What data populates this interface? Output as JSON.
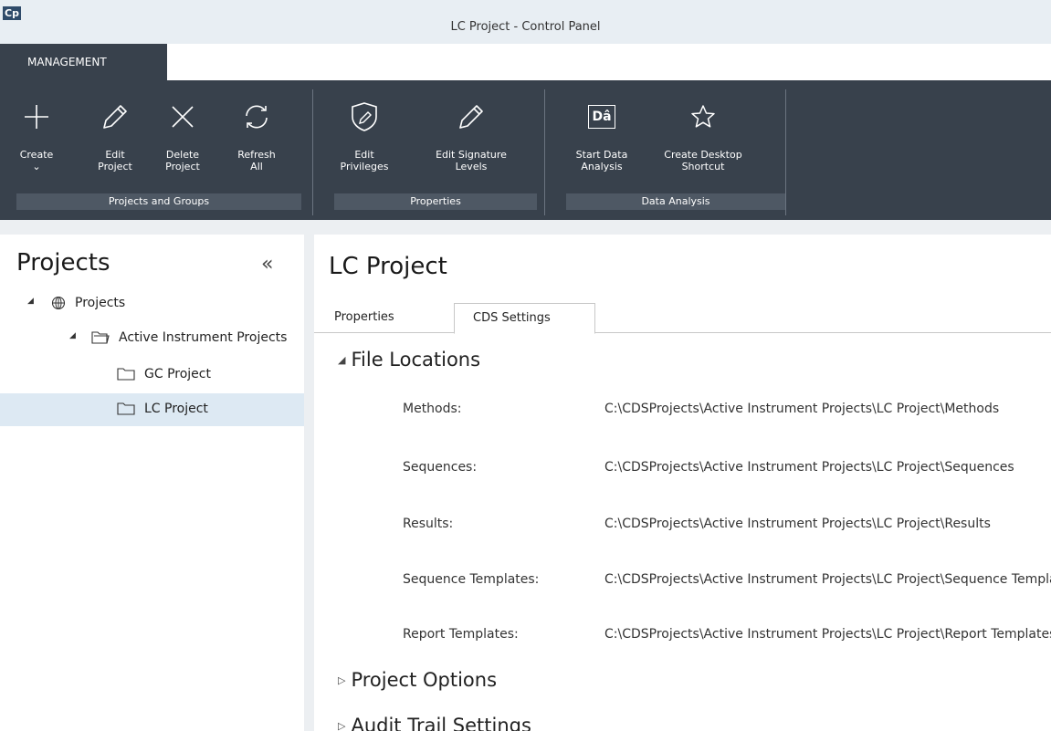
{
  "app": {
    "icon_text": "Cp",
    "window_title": "LC Project - Control Panel"
  },
  "ribbon": {
    "tab": "MANAGEMENT",
    "groups": [
      {
        "label": "Projects and Groups",
        "buttons": [
          {
            "label": "Create\n⌄",
            "icon": "plus-icon"
          },
          {
            "label": "Edit\nProject",
            "icon": "pencil-icon"
          },
          {
            "label": "Delete\nProject",
            "icon": "x-icon"
          },
          {
            "label": "Refresh\nAll",
            "icon": "refresh-icon"
          }
        ]
      },
      {
        "label": "Properties",
        "buttons": [
          {
            "label": "Edit\nPrivileges",
            "icon": "shield-edit-icon"
          },
          {
            "label": "Edit Signature\nLevels",
            "icon": "pencil-icon"
          }
        ]
      },
      {
        "label": "Data Analysis",
        "buttons": [
          {
            "label": "Start Data\nAnalysis",
            "icon": "data-analysis-icon",
            "icon_text": "Dâ"
          },
          {
            "label": "Create Desktop\nShortcut",
            "icon": "star-icon"
          }
        ]
      }
    ]
  },
  "left_pane": {
    "title": "Projects",
    "collapse": "«",
    "tree": [
      {
        "label": "Projects",
        "icon": "globe-icon",
        "expanded": true
      },
      {
        "label": "Active Instrument Projects",
        "icon": "folder-open-icon",
        "expanded": true
      },
      {
        "label": "GC Project",
        "icon": "folder-icon"
      },
      {
        "label": "LC Project",
        "icon": "folder-icon",
        "selected": true
      }
    ]
  },
  "main": {
    "title": "LC Project",
    "tabs": [
      {
        "label": "Properties"
      },
      {
        "label": "CDS Settings",
        "active": true
      }
    ],
    "sections": [
      {
        "title": "File Locations",
        "expanded": true
      },
      {
        "title": "Project Options",
        "expanded": false
      },
      {
        "title": "Audit Trail Settings",
        "expanded": false
      }
    ],
    "file_locations": [
      {
        "label": "Methods:",
        "value": "C:\\CDSProjects\\Active Instrument Projects\\LC Project\\Methods"
      },
      {
        "label": "Sequences:",
        "value": "C:\\CDSProjects\\Active Instrument Projects\\LC Project\\Sequences"
      },
      {
        "label": "Results:",
        "value": "C:\\CDSProjects\\Active Instrument Projects\\LC Project\\Results"
      },
      {
        "label": "Sequence Templates:",
        "value": "C:\\CDSProjects\\Active Instrument Projects\\LC Project\\Sequence Templates"
      },
      {
        "label": "Report Templates:",
        "value": "C:\\CDSProjects\\Active Instrument Projects\\LC Project\\Report Templates"
      }
    ]
  }
}
